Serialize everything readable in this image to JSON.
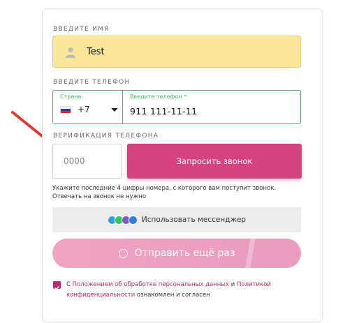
{
  "name_section": {
    "label": "ВВЕДИТЕ ИМЯ",
    "value": "Test"
  },
  "phone_section": {
    "label": "ВВЕДИТЕ ТЕЛЕФОН",
    "country_label": "Страна",
    "country_code": "+7",
    "phone_label": "Введите телефон *",
    "phone_value": "911 111-11-11"
  },
  "verification_section": {
    "label": "ВЕРИФИКАЦИЯ ТЕЛЕФОНА",
    "code_placeholder": "0000",
    "request_call_label": "Запросить звонок",
    "hint": "Укажите последние 4 цифры номера, с которого вам поступит звонок. Отвечать на звонок не нужно"
  },
  "messenger_button_label": "Использовать мессенджер",
  "resend_button_label": "Отправить ещё раз",
  "consent": {
    "prefix": "С ",
    "link1": "Положением об обработке персональных данных",
    "middle": " и ",
    "link2": "Политикой конфиденциальности",
    "suffix": " ознакомлен и согласен",
    "checked": true
  },
  "colors": {
    "accent": "#d6427f",
    "name_field_bg": "#fbe79a",
    "valid_border": "#4fb56d",
    "link": "#c1286d",
    "arrow": "#e03a2f"
  },
  "icons": [
    "user-icon",
    "russia-flag-icon",
    "chevron-down-icon",
    "messenger-icons",
    "check-circle-icon",
    "arrow-annotation"
  ]
}
